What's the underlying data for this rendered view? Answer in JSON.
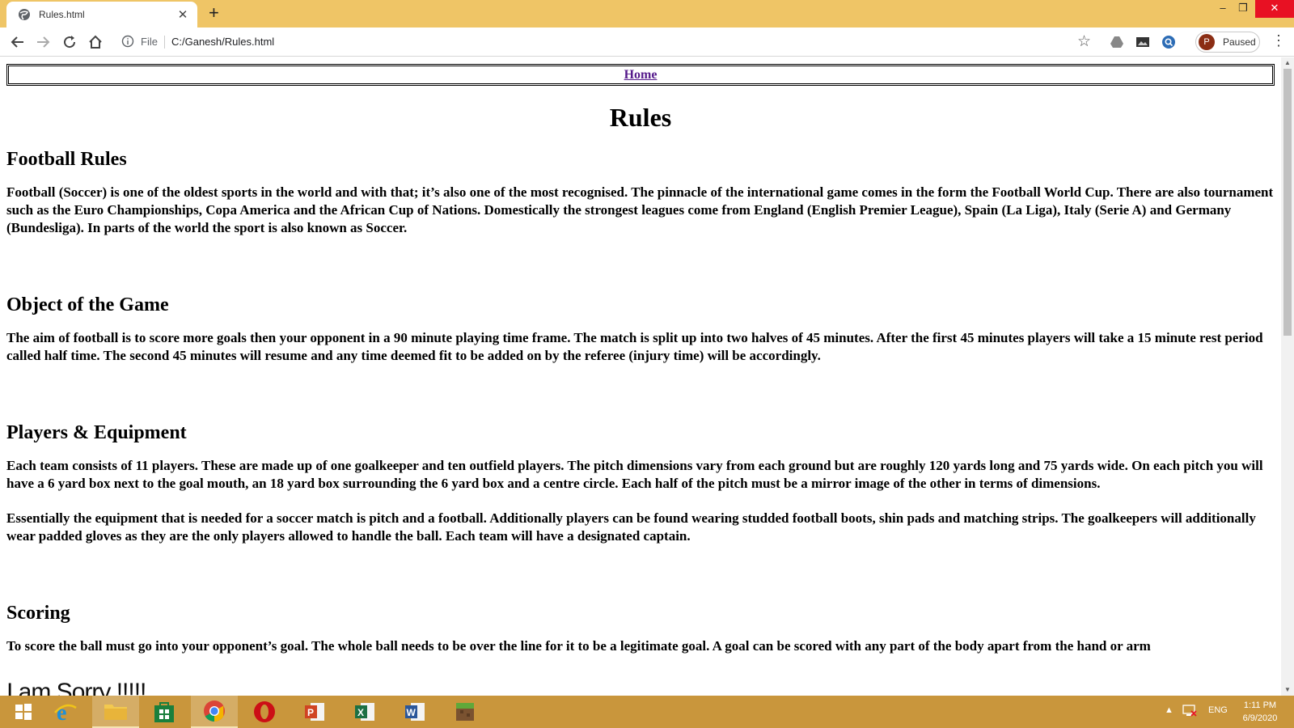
{
  "browser": {
    "tab_title": "Rules.html",
    "tab_close": "✕",
    "new_tab": "+",
    "win_min": "–",
    "win_restore": "❐",
    "win_close": "✕",
    "omnibox_scheme": "File",
    "omnibox_url": "C:/Ganesh/Rules.html",
    "profile_initial": "P",
    "profile_status": "Paused"
  },
  "page": {
    "nav_home": "Home",
    "title": "Rules",
    "sections": [
      {
        "heading": "Football Rules",
        "paragraphs": [
          "Football (Soccer) is one of the oldest sports in the world and with that; it’s also one of the most recognised. The pinnacle of the international game comes in the form the Football World Cup. There are also tournament such as the Euro Championships, Copa America and the African Cup of Nations. Domestically the strongest leagues come from England (English Premier League), Spain (La Liga), Italy (Serie A) and Germany (Bundesliga). In parts of the world the sport is also known as Soccer."
        ]
      },
      {
        "heading": "Object of the Game",
        "paragraphs": [
          "The aim of football is to score more goals then your opponent in a 90 minute playing time frame. The match is split up into two halves of 45 minutes. After the first 45 minutes players will take a 15 minute rest period called half time. The second 45 minutes will resume and any time deemed fit to be added on by the referee (injury time) will be accordingly."
        ]
      },
      {
        "heading": "Players & Equipment",
        "paragraphs": [
          "Each team consists of 11 players. These are made up of one goalkeeper and ten outfield players. The pitch dimensions vary from each ground but are roughly 120 yards long and 75 yards wide. On each pitch you will have a 6 yard box next to the goal mouth, an 18 yard box surrounding the 6 yard box and a centre circle. Each half of the pitch must be a mirror image of the other in terms of dimensions.",
          "Essentially the equipment that is needed for a soccer match is pitch and a football. Additionally players can be found wearing studded football boots, shin pads and matching strips. The goalkeepers will additionally wear padded gloves as they are the only players allowed to handle the ball. Each team will have a designated captain."
        ]
      },
      {
        "heading": "Scoring",
        "paragraphs": [
          "To score the ball must go into your opponent’s goal. The whole ball needs to be over the line for it to be a legitimate goal. A goal can be scored with any part of the body apart from the hand or arm"
        ]
      }
    ],
    "overlay_text": "I am Sorry !!!!!"
  },
  "taskbar": {
    "apps": [
      "start-icon",
      "internet-explorer-icon",
      "file-explorer-icon",
      "store-icon",
      "chrome-icon",
      "opera-icon",
      "powerpoint-icon",
      "excel-icon",
      "word-icon",
      "minecraft-icon"
    ],
    "tray_arrow": "▲",
    "language": "ENG",
    "time": "1:11 PM",
    "date": "6/9/2020"
  },
  "colors": {
    "titlebar": "#efc566",
    "taskbar": "#c9963c",
    "link_visited": "#551a8b"
  }
}
